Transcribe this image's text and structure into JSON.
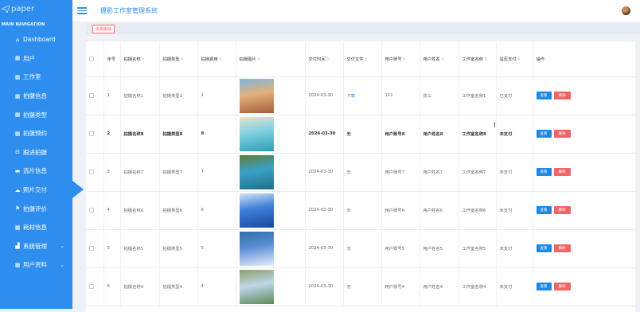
{
  "app": {
    "logo_text": "paper",
    "title": "摄影工作室管理系统"
  },
  "sidebar": {
    "section_title": "MAIN NAVIGATION",
    "items": [
      {
        "label": "Dashboard",
        "icon": "home-icon"
      },
      {
        "label": "用户",
        "icon": "grid-icon"
      },
      {
        "label": "工作室",
        "icon": "grid-icon"
      },
      {
        "label": "拍摄信息",
        "icon": "grid-icon"
      },
      {
        "label": "拍摄类型",
        "icon": "grid-icon"
      },
      {
        "label": "拍摄预约",
        "icon": "grid-icon"
      },
      {
        "label": "跟进拍摄",
        "icon": "inbox-icon"
      },
      {
        "label": "选片信息",
        "icon": "card-icon"
      },
      {
        "label": "照片交付",
        "icon": "cloud-icon"
      },
      {
        "label": "拍摄评价",
        "icon": "flag-icon"
      },
      {
        "label": "耗材信息",
        "icon": "grid-icon"
      },
      {
        "label": "系统管理",
        "icon": "chart-icon"
      },
      {
        "label": "用户资料",
        "icon": "grid-icon"
      }
    ]
  },
  "toolbar": {
    "batch_delete": "批量删除"
  },
  "table": {
    "headers": [
      "序号",
      "拍摄名称",
      "拍摄类型",
      "拍摄费用",
      "拍摄图片",
      "交付时间",
      "交付文件",
      "用户账号",
      "用户姓名",
      "工作室名称",
      "是否支付",
      "操作"
    ],
    "view_label": "查看",
    "delete_label": "删除",
    "rows": [
      {
        "no": "1",
        "name": "拍摄名称1",
        "type": "拍摄类型1",
        "fee": "1",
        "img": [
          "#e3b07a",
          "#a45d3a",
          "#7fb6e0"
        ],
        "time": "2024-03-30",
        "file": "下载",
        "account": "111",
        "username": "张三",
        "studio": "工作室名称1",
        "paid": "已支付"
      },
      {
        "no": "2",
        "name": "拍摄名称8",
        "type": "拍摄类型8",
        "fee": "8",
        "img": [
          "#7fd0e0",
          "#2e9fb6",
          "#e8e2cf"
        ],
        "time": "2024-03-30",
        "file": "无",
        "account": "用户账号8",
        "username": "用户姓名8",
        "studio": "工作室名称8",
        "paid": "未支付"
      },
      {
        "no": "3",
        "name": "拍摄名称7",
        "type": "拍摄类型7",
        "fee": "7",
        "img": [
          "#3aa0c8",
          "#1f6f8a",
          "#5c7d3a"
        ],
        "time": "2024-03-30",
        "file": "无",
        "account": "用户账号7",
        "username": "用户姓名7",
        "studio": "工作室名称7",
        "paid": "未支付"
      },
      {
        "no": "4",
        "name": "拍摄名称6",
        "type": "拍摄类型6",
        "fee": "6",
        "img": [
          "#3d7dd8",
          "#1a4a9e",
          "#cfe3f5"
        ],
        "time": "2024-03-30",
        "file": "无",
        "account": "用户账号6",
        "username": "用户姓名6",
        "studio": "工作室名称6",
        "paid": "未支付"
      },
      {
        "no": "5",
        "name": "拍摄名称5",
        "type": "拍摄类型5",
        "fee": "5",
        "img": [
          "#5b8fd6",
          "#e6eef7",
          "#2f6fa8"
        ],
        "time": "2024-03-30",
        "file": "无",
        "account": "用户账号5",
        "username": "用户姓名5",
        "studio": "工作室名称5",
        "paid": "未支付"
      },
      {
        "no": "6",
        "name": "拍摄名称4",
        "type": "拍摄类型4",
        "fee": "4",
        "img": [
          "#bfd6e8",
          "#5f8a5a",
          "#8aa06a"
        ],
        "time": "2024-03-30",
        "file": "无",
        "account": "用户账号4",
        "username": "用户姓名4",
        "studio": "工作室名称4",
        "paid": "未支付"
      }
    ]
  }
}
